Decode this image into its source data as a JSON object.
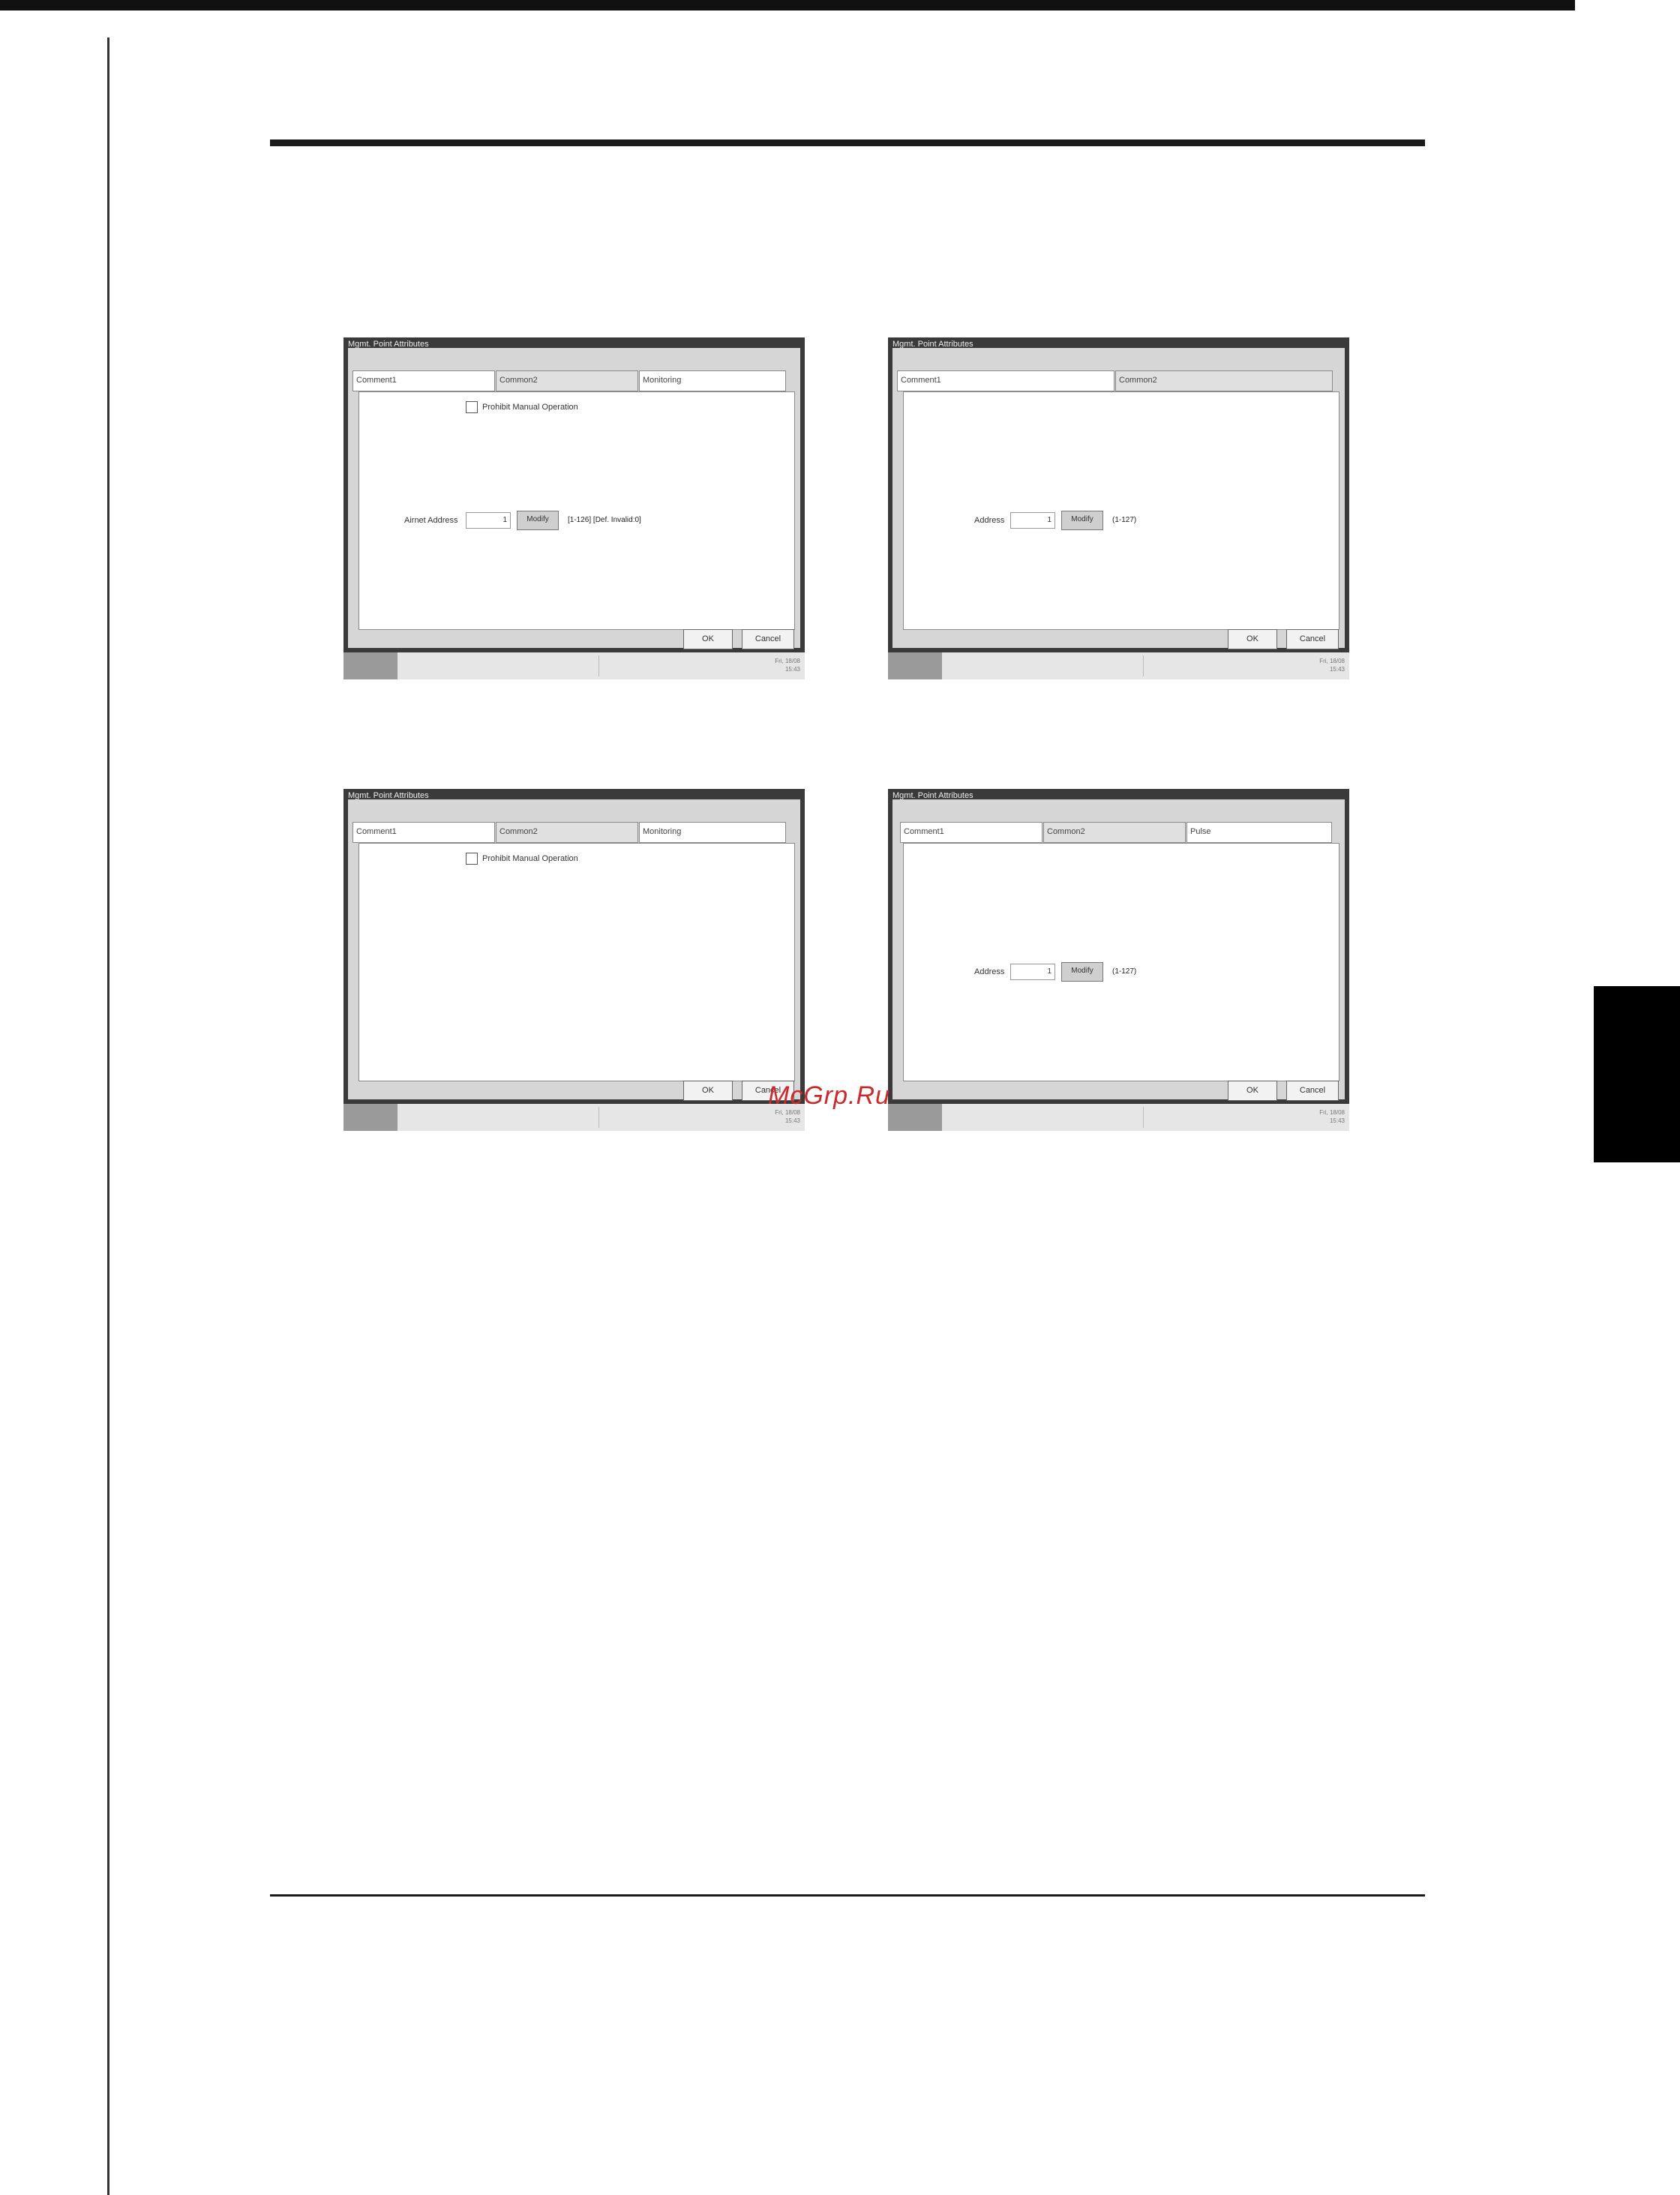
{
  "watermark": "McGrp.Ru",
  "screens": [
    {
      "title": "Mgmt. Point Attributes",
      "tabs": [
        "Comment1",
        "Common2",
        "Monitoring"
      ],
      "checkbox_label": "Prohibit Manual Operation",
      "address_label": "Airnet Address",
      "address_value": "1",
      "modify_label": "Modify",
      "range": "[1-126] [Def. Invalid:0]",
      "ok": "OK",
      "cancel": "Cancel",
      "status": "Fri, 18/08\n15:43"
    },
    {
      "title": "Mgmt. Point Attributes",
      "tabs": [
        "Comment1",
        "Common2"
      ],
      "address_label": "Address",
      "address_value": "1",
      "modify_label": "Modify",
      "range": "(1-127)",
      "ok": "OK",
      "cancel": "Cancel",
      "status": "Fri, 18/08\n15:43"
    },
    {
      "title": "Mgmt. Point Attributes",
      "tabs": [
        "Comment1",
        "Common2",
        "Monitoring"
      ],
      "checkbox_label": "Prohibit Manual Operation",
      "ok": "OK",
      "cancel": "Cancel",
      "status": "Fri, 18/08\n15:43"
    },
    {
      "title": "Mgmt. Point Attributes",
      "tabs": [
        "Comment1",
        "Common2",
        "Pulse"
      ],
      "address_label": "Address",
      "address_value": "1",
      "modify_label": "Modify",
      "range": "(1-127)",
      "ok": "OK",
      "cancel": "Cancel",
      "status": "Fri, 18/08\n15:43"
    }
  ]
}
